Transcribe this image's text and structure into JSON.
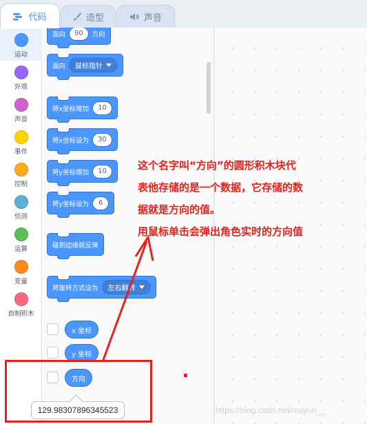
{
  "tabs": [
    {
      "label": "代码",
      "icon": "code-icon",
      "active": true
    },
    {
      "label": "造型",
      "icon": "brush-icon",
      "active": false
    },
    {
      "label": "声音",
      "icon": "speaker-icon",
      "active": false
    }
  ],
  "categories": [
    {
      "label": "运动",
      "color": "#4c97ff"
    },
    {
      "label": "外观",
      "color": "#9966ff"
    },
    {
      "label": "声音",
      "color": "#cf63cf"
    },
    {
      "label": "事件",
      "color": "#ffd500"
    },
    {
      "label": "控制",
      "color": "#ffab19"
    },
    {
      "label": "侦测",
      "color": "#5cb1d6"
    },
    {
      "label": "运算",
      "color": "#59c059"
    },
    {
      "label": "变量",
      "color": "#ff8c1a"
    },
    {
      "label": "自制积木",
      "color": "#ff6680"
    }
  ],
  "blocks": {
    "point_dir": {
      "label": "面向",
      "value": "90",
      "suffix": "方向"
    },
    "point_to": {
      "label": "面向",
      "option": "鼠标指针"
    },
    "change_x": {
      "label": "将x坐标增加",
      "value": "10"
    },
    "set_x": {
      "label": "将x坐标设为",
      "value": "30"
    },
    "change_y": {
      "label": "将y坐标增加",
      "value": "10"
    },
    "set_y": {
      "label": "将y坐标设为",
      "value": "6"
    },
    "bounce": {
      "label": "碰到边缘就反弹"
    },
    "rotation_style": {
      "label": "将旋转方式设为",
      "option": "左右翻转"
    }
  },
  "reporters": {
    "x_position": "x 坐标",
    "y_position": "y 坐标",
    "direction": "方向"
  },
  "direction_value": "129.98307896345523",
  "annotation": {
    "lines": [
      "这个名字叫“方向”的圆形积木块代",
      "表他存储的是一个数据，它存储的数",
      "据就是方向的值。",
      "用鼠标单击会弹出角色实时的方向值"
    ],
    "color": "#e8201c"
  },
  "watermark": "https://blog.csdn.net/mayun__",
  "colors": {
    "motion": "#4c97ff",
    "motion_dark": "#3373cc",
    "accent_red": "#e8201c"
  }
}
